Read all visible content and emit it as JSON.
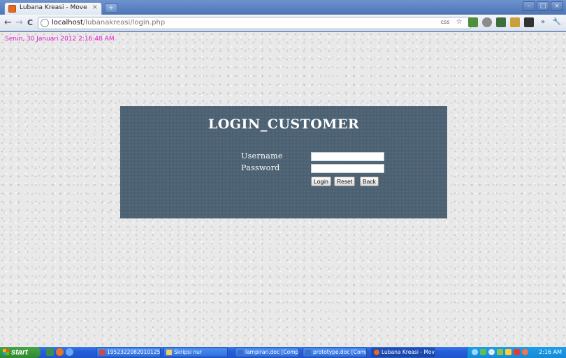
{
  "browser": {
    "tab_title": "Lubana Kreasi - Move Into the",
    "tab_close": "×",
    "new_tab": "+",
    "address_host": "localhost",
    "address_path": "/lubanakreasi/login.php",
    "nav_back": "←",
    "nav_forward": "→",
    "nav_reload": "C",
    "tool_css": "css",
    "tool_star": "☆",
    "tool_more": "»",
    "tool_wrench": "🔧",
    "win_minimize": "–",
    "win_maximize": "□",
    "win_close": "×"
  },
  "page": {
    "datetime": "Senin, 30 Januari 2012 2:16:48 AM",
    "login": {
      "title": "LOGIN_CUSTOMER",
      "username_label": "Username",
      "password_label": "Password",
      "username_value": "",
      "password_value": "",
      "login_button": "Login",
      "reset_button": "Reset",
      "back_button": "Back"
    }
  },
  "taskbar": {
    "start_label": "start",
    "items": [
      {
        "label": "19523220820101256..."
      },
      {
        "label": "Skripsi nur"
      },
      {
        "label": "lampiran.doc [Compa..."
      },
      {
        "label": "prototype.doc [Comp..."
      },
      {
        "label": "Lubana Kreasi - Move..."
      }
    ],
    "clock": "2:16 AM"
  },
  "colors": {
    "panel": "#4d6375",
    "datetime": "#e11ad1",
    "taskbar": "#245edb",
    "start": "#2f8a2f"
  }
}
